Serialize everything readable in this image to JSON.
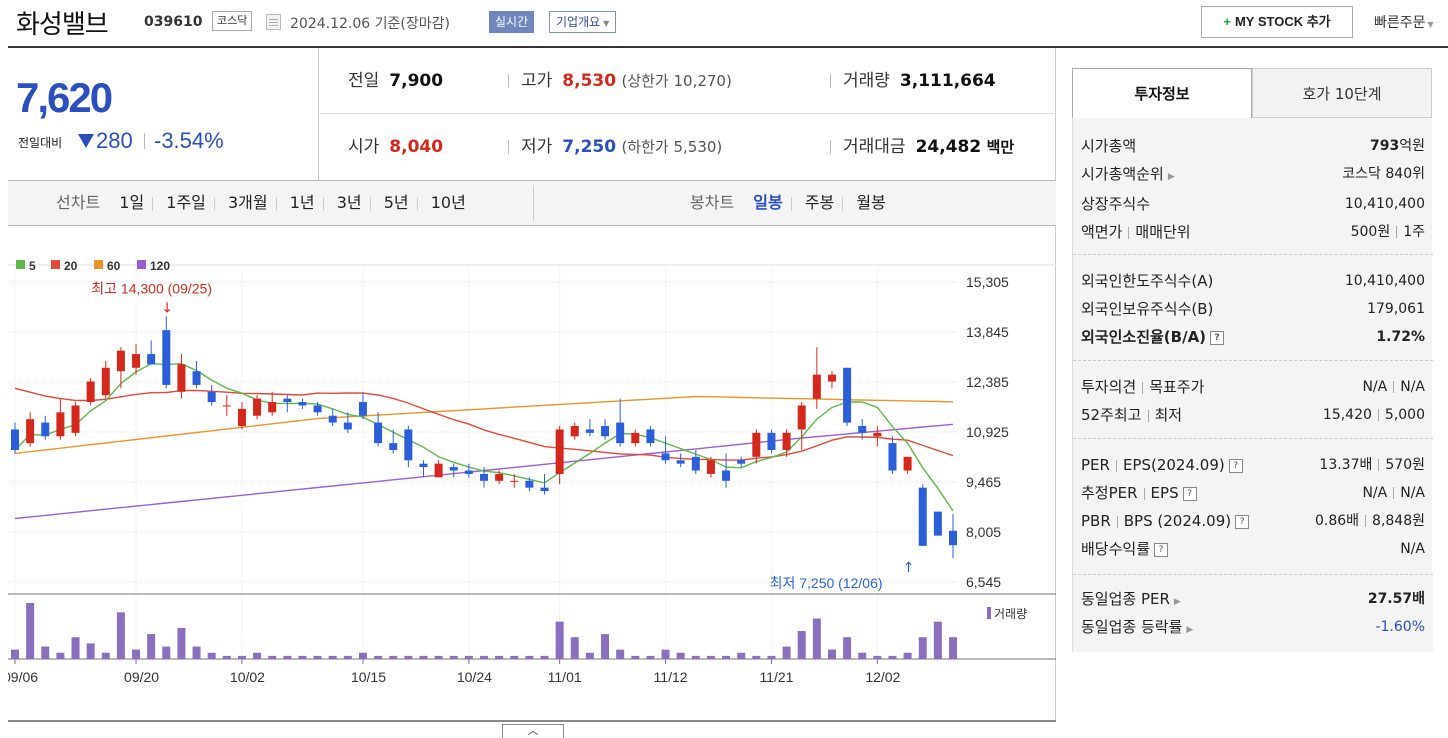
{
  "header": {
    "stock_name": "화성밸브",
    "stock_code": "039610",
    "market": "코스닥",
    "date_text": "2024.12.06  기준(장마감)",
    "realtime_label": "실시간",
    "corp_label": "기업개요",
    "mystock_label": "MY STOCK 추가",
    "quick_order_label": "빠른주문"
  },
  "price": {
    "current": "7,620",
    "change_label": "전일대비",
    "change": "280",
    "change_pct": "-3.54%"
  },
  "stats": {
    "prev_close_label": "전일",
    "prev_close": "7,900",
    "high_label": "고가",
    "high": "8,530",
    "upper_limit": "(상한가 10,270)",
    "volume_label": "거래량",
    "volume": "3,111,664",
    "open_label": "시가",
    "open": "8,040",
    "low_label": "저가",
    "low": "7,250",
    "lower_limit": "(하한가 5,530)",
    "trade_value_label": "거래대금",
    "trade_value": "24,482",
    "trade_value_unit": "백만"
  },
  "period": {
    "line_label": "선차트",
    "line_options": [
      "1일",
      "1주일",
      "3개월",
      "1년",
      "3년",
      "5년",
      "10년"
    ],
    "candle_label": "봉차트",
    "candle_options": [
      "일봉",
      "주봉",
      "월봉"
    ],
    "candle_active": 0
  },
  "tabs": {
    "invest": "투자정보",
    "orderbook": "호가 10단계"
  },
  "info": {
    "market_cap_label": "시가총액",
    "market_cap": "793",
    "market_cap_unit": "억원",
    "market_cap_rank_label": "시가총액순위",
    "market_cap_rank": "코스닥 840위",
    "shares_label": "상장주식수",
    "shares": "10,410,400",
    "par_label": "액면가",
    "unit_label": "매매단위",
    "par": "500원",
    "unit": "1주",
    "foreign_limit_label": "외국인한도주식수(A)",
    "foreign_limit": "10,410,400",
    "foreign_hold_label": "외국인보유주식수(B)",
    "foreign_hold": "179,061",
    "foreign_ratio_label": "외국인소진율(B/A)",
    "foreign_ratio": "1.72%",
    "opinion_label": "투자의견",
    "target_label": "목표주가",
    "opinion": "N/A",
    "target": "N/A",
    "w52_high_label": "52주최고",
    "w52_low_label": "최저",
    "w52_high": "15,420",
    "w52_low": "5,000",
    "per_label": "PER",
    "eps_label": "EPS(2024.09)",
    "per": "13.37배",
    "eps": "570원",
    "est_per_label": "추정PER",
    "est_eps_label": "EPS",
    "est_per": "N/A",
    "est_eps": "N/A",
    "pbr_label": "PBR",
    "bps_label": "BPS (2024.09)",
    "pbr": "0.86배",
    "bps": "8,848원",
    "div_label": "배당수익률",
    "div": "N/A",
    "ind_per_label": "동일업종 PER",
    "ind_per": "27.57배",
    "ind_change_label": "동일업종 등락률",
    "ind_change": "-1.60%"
  },
  "chart_data": {
    "type": "candlestick",
    "legend": [
      {
        "name": "5",
        "color": "#5fb84a"
      },
      {
        "name": "20",
        "color": "#e0483c"
      },
      {
        "name": "60",
        "color": "#e8962a"
      },
      {
        "name": "120",
        "color": "#9b5fd1"
      }
    ],
    "y_ticks": [
      15305,
      13845,
      12385,
      10925,
      9465,
      8005,
      6545
    ],
    "x_ticks": [
      "09/06",
      "09/20",
      "10/02",
      "10/15",
      "10/24",
      "11/01",
      "11/12",
      "11/21",
      "12/02"
    ],
    "x_tick_index": [
      0,
      8,
      15,
      23,
      30,
      36,
      43,
      50,
      57
    ],
    "up_color": "#d4281c",
    "down_color": "#2b5fd9",
    "high_annotation": "최고 14,300 (09/25)",
    "high_annotation_index": 10,
    "high_annotation_value": 14300,
    "low_annotation": "최저 7,250 (12/06)",
    "low_annotation_index": 59,
    "low_annotation_value": 7250,
    "volume_label": "거래량",
    "ohlc": [
      [
        11000,
        11200,
        10300,
        10400
      ],
      [
        10600,
        11500,
        10500,
        11300
      ],
      [
        11200,
        11400,
        10700,
        10800
      ],
      [
        10800,
        11900,
        10700,
        11500
      ],
      [
        10900,
        11800,
        10800,
        11700
      ],
      [
        11800,
        12500,
        11700,
        12400
      ],
      [
        12000,
        13000,
        11900,
        12800
      ],
      [
        12700,
        13400,
        12200,
        13300
      ],
      [
        12800,
        13500,
        12600,
        13200
      ],
      [
        13200,
        13600,
        12900,
        12900
      ],
      [
        13900,
        14300,
        12200,
        12300
      ],
      [
        12100,
        13200,
        11900,
        12900
      ],
      [
        12700,
        13000,
        12200,
        12300
      ],
      [
        12100,
        12300,
        11700,
        11800
      ],
      [
        11700,
        12000,
        11400,
        11700
      ],
      [
        11100,
        11800,
        11000,
        11600
      ],
      [
        11400,
        12000,
        11300,
        11900
      ],
      [
        11500,
        12100,
        11400,
        11800
      ],
      [
        11900,
        12000,
        11500,
        11800
      ],
      [
        11800,
        11900,
        11600,
        11700
      ],
      [
        11700,
        11800,
        11400,
        11500
      ],
      [
        11400,
        11600,
        11100,
        11200
      ],
      [
        11200,
        11500,
        10900,
        11000
      ],
      [
        11800,
        12100,
        11300,
        11400
      ],
      [
        11200,
        11500,
        10500,
        10600
      ],
      [
        10600,
        11000,
        10300,
        10400
      ],
      [
        11000,
        11100,
        9900,
        10100
      ],
      [
        10000,
        10100,
        9600,
        9900
      ],
      [
        9600,
        10100,
        9600,
        10000
      ],
      [
        9900,
        10000,
        9600,
        9800
      ],
      [
        9800,
        10000,
        9600,
        9700
      ],
      [
        9700,
        9900,
        9300,
        9500
      ],
      [
        9500,
        9800,
        9400,
        9700
      ],
      [
        9500,
        9700,
        9300,
        9500
      ],
      [
        9500,
        9600,
        9200,
        9300
      ],
      [
        9300,
        9700,
        9100,
        9200
      ],
      [
        9700,
        11100,
        9400,
        11000
      ],
      [
        10800,
        11200,
        10700,
        11100
      ],
      [
        11000,
        11300,
        10800,
        10900
      ],
      [
        11100,
        11300,
        10700,
        10800
      ],
      [
        11200,
        11900,
        10500,
        10600
      ],
      [
        10600,
        11000,
        10500,
        10900
      ],
      [
        11000,
        11100,
        10500,
        10600
      ],
      [
        10300,
        10800,
        10000,
        10100
      ],
      [
        10100,
        10300,
        9900,
        10000
      ],
      [
        10200,
        10400,
        9700,
        9800
      ],
      [
        9700,
        10200,
        9600,
        10100
      ],
      [
        9800,
        10300,
        9300,
        9500
      ],
      [
        10100,
        10200,
        9900,
        10000
      ],
      [
        10200,
        11000,
        10000,
        10900
      ],
      [
        10900,
        11000,
        10300,
        10400
      ],
      [
        10400,
        11000,
        10200,
        10900
      ],
      [
        11000,
        11800,
        10400,
        11700
      ],
      [
        11900,
        13400,
        11600,
        12600
      ],
      [
        12400,
        12700,
        12200,
        12600
      ],
      [
        12800,
        12800,
        11100,
        11200
      ],
      [
        11100,
        11300,
        10700,
        10900
      ],
      [
        10800,
        11100,
        10500,
        10900
      ],
      [
        10600,
        10800,
        9700,
        9800
      ],
      [
        9800,
        10200,
        9700,
        10200
      ],
      [
        9300,
        9400,
        7600,
        7600
      ],
      [
        8600,
        8600,
        7900,
        7900
      ],
      [
        8040,
        8530,
        7250,
        7620
      ]
    ],
    "volume": [
      3,
      18,
      4,
      2,
      7,
      5,
      2,
      15,
      3,
      8,
      4,
      10,
      4,
      2,
      1,
      1,
      2,
      1,
      1,
      1,
      1,
      1,
      1,
      2,
      1,
      1,
      1,
      1,
      1,
      1,
      1,
      1,
      1,
      1,
      1,
      1,
      12,
      7,
      2,
      8,
      3,
      1,
      1,
      3,
      2,
      1,
      1,
      1,
      2,
      1,
      1,
      4,
      9,
      13,
      3,
      7,
      2,
      1,
      1,
      2,
      7,
      12,
      7
    ]
  }
}
